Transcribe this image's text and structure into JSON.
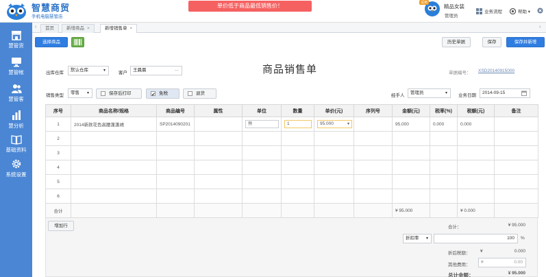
{
  "header": {
    "brand": "智慧商贸",
    "brand_sub": "手机电脑慧管店",
    "alert": "单价低于商品最低销售价！",
    "trial_badge": "试用",
    "shop_name": "精品女装",
    "user_role": "管理员",
    "nav": [
      {
        "label": "业务流程",
        "icon": "workflow-icon"
      },
      {
        "label": "帮助 ▾",
        "icon": "help-icon"
      },
      {
        "label": "",
        "icon": "close-icon"
      }
    ]
  },
  "sidebar": {
    "items": [
      {
        "label": "慧管货",
        "icon": "store-icon"
      },
      {
        "label": "慧管帐",
        "icon": "monitor-icon"
      },
      {
        "label": "慧管客",
        "icon": "users-icon"
      },
      {
        "label": "慧分析",
        "icon": "chart-icon"
      },
      {
        "label": "基础资料",
        "icon": "book-icon"
      },
      {
        "label": "系统设置",
        "icon": "gear-icon"
      }
    ]
  },
  "tabs": [
    {
      "label": "首页",
      "closable": false
    },
    {
      "label": "新增商品",
      "closable": true
    },
    {
      "label": "新增销售单",
      "closable": true,
      "active": true
    }
  ],
  "toolbar": {
    "select_goods": "选择商品",
    "history": "历史单据",
    "save": "保存",
    "save_new": "保存并新增"
  },
  "form": {
    "title": "商品销售单",
    "warehouse_label": "出库仓库",
    "warehouse_value": "默认仓库",
    "customer_label": "客户",
    "customer_value": "王晨晨",
    "customer_more": "···",
    "order_no_label": "单据编号：",
    "order_no_value": "XSD20140915000",
    "sales_type_label": "销售类型",
    "sales_type_value": "零售",
    "print_after_save": "保存后打印",
    "tax_free": "免税",
    "return_goods": "退货",
    "handler_label": "经手人",
    "handler_value": "管理员",
    "date_label": "业务日期",
    "date_value": "2014-09-15"
  },
  "table": {
    "headers": [
      "序号",
      "商品名称/规格",
      "商品编号",
      "属性",
      "单位",
      "数量",
      "单价(元)",
      "序列号",
      "金额(元)",
      "税率(%)",
      "税额(元)",
      "备注"
    ],
    "rows": [
      {
        "no": "1",
        "name": "2014新款花色高腰蓬蓬裙",
        "code": "SP2014090201",
        "unit": "件",
        "qty": "1",
        "price": "95.000",
        "amount": "95.000",
        "tax_rate": "0.000",
        "tax": "0.000"
      },
      {
        "no": "2"
      },
      {
        "no": "3"
      },
      {
        "no": "4"
      },
      {
        "no": "5"
      },
      {
        "no": "6"
      }
    ],
    "total_label": "合计",
    "total_amount": "¥ 95.000",
    "total_tax": "¥ 0.000"
  },
  "bottom": {
    "add_row": "增加行",
    "subtotal_label": "合计：",
    "subtotal_value": "¥ 95.000",
    "discount_type": "折扣率",
    "discount_value": "100",
    "discount_unit": "%",
    "after_discount_label": "折后税额：",
    "after_discount_currency": "¥",
    "after_discount_value": "0.000",
    "other_fee_label": "其他费用：",
    "other_fee_currency": "¥",
    "other_fee_value": "0.00",
    "grand_total_label": "总计金额：",
    "grand_total_value": "¥ 95.000"
  },
  "colors": {
    "primary": "#2f7de1",
    "sidebar": "#4a86d4",
    "alert": "#f56161",
    "total_red": "#e2211c"
  }
}
